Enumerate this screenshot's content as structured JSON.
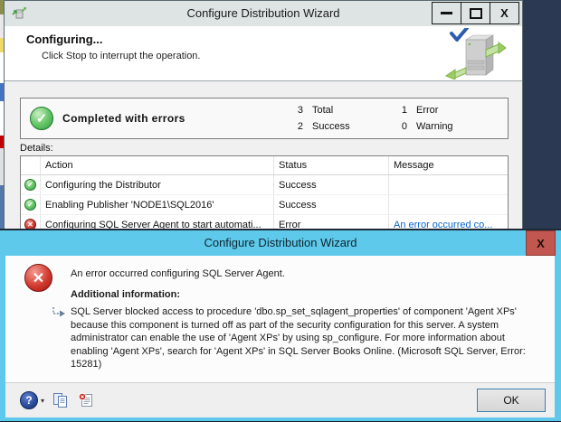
{
  "colors": {
    "desktop": "#2B3A52",
    "accent_blue": "#5EC9EA",
    "close_red": "#C15750",
    "success_green": "#2F9E3F",
    "error_red": "#D23B30",
    "link_blue": "#0B63CE"
  },
  "icons": {
    "check": "✓",
    "cross": "✕",
    "help": "?",
    "dropdown": "▾"
  },
  "main_window": {
    "title": "Configure Distribution Wizard",
    "close_glyph": "X",
    "header": {
      "title": "Configuring...",
      "subtitle": "Click Stop to interrupt the operation."
    },
    "summary": {
      "status_label": "Completed with errors",
      "counts": [
        {
          "n": "3",
          "label": "Total"
        },
        {
          "n": "2",
          "label": "Success"
        },
        {
          "n": "1",
          "label": "Error"
        },
        {
          "n": "0",
          "label": "Warning"
        }
      ]
    },
    "details_label": "Details:",
    "table": {
      "headers": {
        "action": "Action",
        "status": "Status",
        "message": "Message"
      },
      "rows": [
        {
          "action": "Configuring the Distributor",
          "status": "Success",
          "message": ""
        },
        {
          "action": "Enabling Publisher 'NODE1\\SQL2016'",
          "status": "Success",
          "message": ""
        },
        {
          "action": "Configuring SQL Server Agent to start automati...",
          "status": "Error",
          "message": "An error occurred co..."
        }
      ]
    }
  },
  "error_dialog": {
    "title": "Configure Distribution Wizard",
    "close_glyph": "X",
    "message": "An error occurred configuring SQL Server Agent.",
    "additional_info_label": "Additional information:",
    "detail": "SQL Server blocked access to procedure 'dbo.sp_set_sqlagent_properties' of component 'Agent XPs' because this component is turned off as part of the security configuration for this server. A system administrator can enable the use of 'Agent XPs' by using sp_configure. For more information about enabling 'Agent XPs', search for 'Agent XPs' in SQL Server Books Online. (Microsoft SQL Server, Error: 15281)",
    "ok_label": "OK"
  }
}
